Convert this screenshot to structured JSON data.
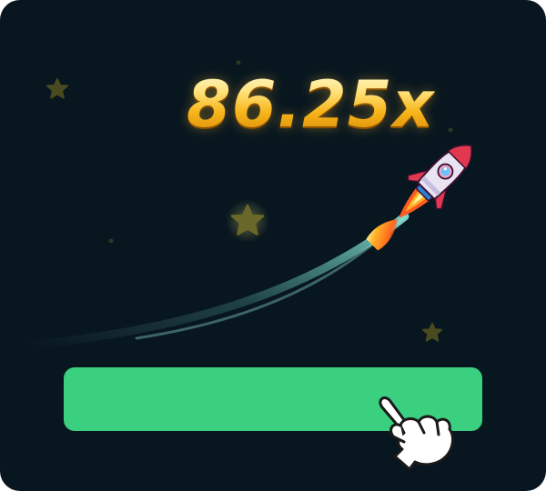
{
  "game": {
    "multiplier": "86.25x",
    "cashout_label": ""
  },
  "colors": {
    "background": "#08161f",
    "multiplier_gold": "#ffc21a",
    "button_green": "#3ad07f",
    "star": "#5c5a24",
    "trail": "#7fe3d6"
  },
  "icons": {
    "rocket": "rocket-icon",
    "pointer": "hand-pointer-icon",
    "star": "star-icon"
  }
}
